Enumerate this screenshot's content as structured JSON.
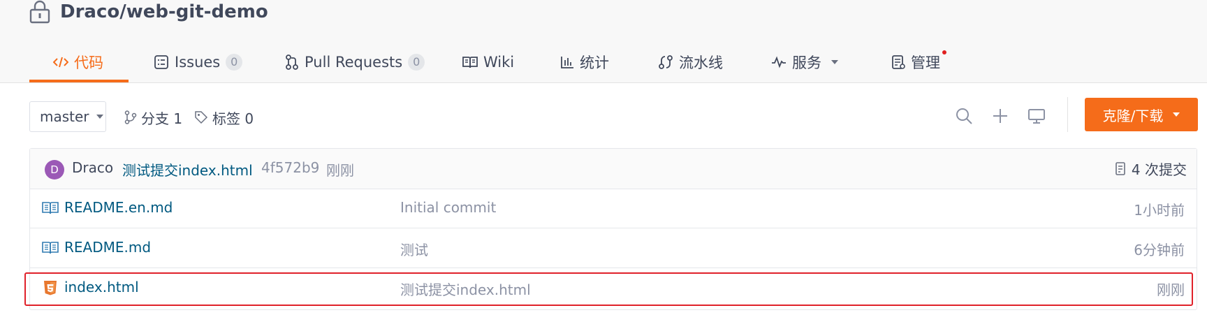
{
  "repo": {
    "title": "Draco/web-git-demo",
    "lock_icon": "lock-icon"
  },
  "tabs": [
    {
      "label": "代码",
      "icon": "code-icon",
      "active": true
    },
    {
      "label": "Issues",
      "icon": "issues-icon",
      "count": "0"
    },
    {
      "label": "Pull Requests",
      "icon": "pull-request-icon",
      "count": "0"
    },
    {
      "label": "Wiki",
      "icon": "wiki-book-icon"
    },
    {
      "label": "统计",
      "icon": "bar-chart-icon"
    },
    {
      "label": "流水线",
      "icon": "pipeline-icon"
    },
    {
      "label": "服务",
      "icon": "pulse-icon",
      "dropdown": true
    },
    {
      "label": "管理",
      "icon": "manage-icon",
      "notification_dot": true
    }
  ],
  "toolbar": {
    "branch": "master",
    "branches_label": "分支 1",
    "tags_label": "标签 0",
    "clone_label": "克隆/下载"
  },
  "latest_commit": {
    "avatar_letter": "D",
    "author": "Draco",
    "message": "测试提交index.html",
    "hash": "4f572b9",
    "time": "刚刚",
    "commit_count": "4 次提交"
  },
  "files": [
    {
      "name": "README.en.md",
      "icon": "readme-book-icon",
      "message": "Initial commit",
      "time": "1小时前"
    },
    {
      "name": "README.md",
      "icon": "readme-book-icon",
      "message": "测试",
      "time": "6分钟前"
    },
    {
      "name": "index.html",
      "icon": "html5-icon",
      "message": "测试提交index.html",
      "time": "刚刚"
    }
  ],
  "colors": {
    "accent": "#f56c1a",
    "link": "#005980",
    "muted": "#8c92a4",
    "highlight": "#e0212a",
    "avatar": "#9b59b6"
  }
}
